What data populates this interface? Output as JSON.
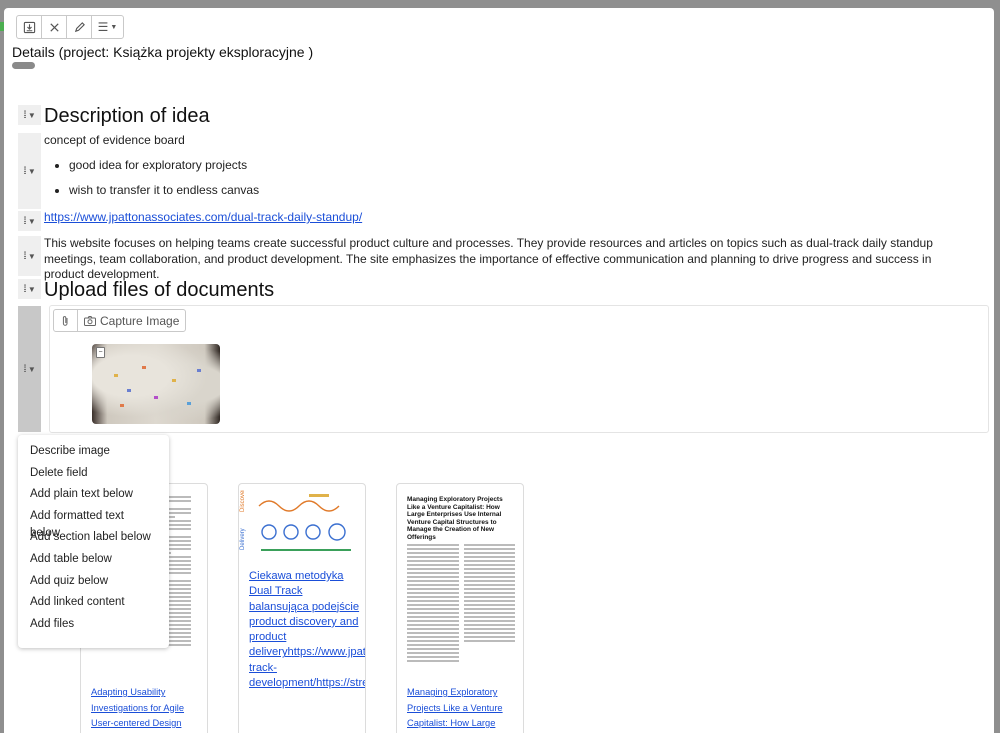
{
  "toolbar": {
    "buttons": [
      {
        "name": "save-icon"
      },
      {
        "name": "close-icon"
      },
      {
        "name": "edit-icon"
      },
      {
        "name": "menu-icon"
      }
    ]
  },
  "header": {
    "title": "Details (project: Książka projekty eksploracyjne )"
  },
  "blocks": {
    "description_heading": "Description of idea",
    "description_text": "concept of evidence board",
    "bullets": [
      "good idea for exploratory projects",
      "wish to transfer it to endless canvas"
    ],
    "link": "https://www.jpattonassociates.com/dual-track-daily-standup/",
    "paragraph": "This website focuses on helping teams create successful product culture and processes. They provide resources and articles on topics such as dual-track daily standup meetings, team collaboration, and product development. The site emphasizes the importance of effective communication and planning to drive progress and success in product development.",
    "upload_heading": "Upload files of documents"
  },
  "upload": {
    "capture_label": "Capture Image"
  },
  "context_menu": {
    "items": [
      "Describe image",
      "Delete field",
      "Add plain text below",
      "Add formatted text below",
      "Add section label below",
      "Add table below",
      "Add quiz below",
      "Add linked content",
      "Add files"
    ]
  },
  "files": [
    {
      "title": "Adapting Usability Investigations for Agile User-centered Design"
    },
    {
      "title": "Ciekawa metodyka Dual Track balansująca podejście product discovery and product deliveryhttps://www.jpattonassociates.com/dual-track-development/https://strefapmi.pl/strefa-"
    },
    {
      "title": "Managing Exploratory Projects Like a Venture Capitalist: How Large",
      "doc_heading": "Managing Exploratory Projects Like a Venture Capitalist: How Large Enterprises Use Internal Venture Capital Structures to Manage the Creation of New Offerings"
    }
  ],
  "colors": {
    "link": "#1a4ed8",
    "backdrop": "#8f8f8f"
  }
}
